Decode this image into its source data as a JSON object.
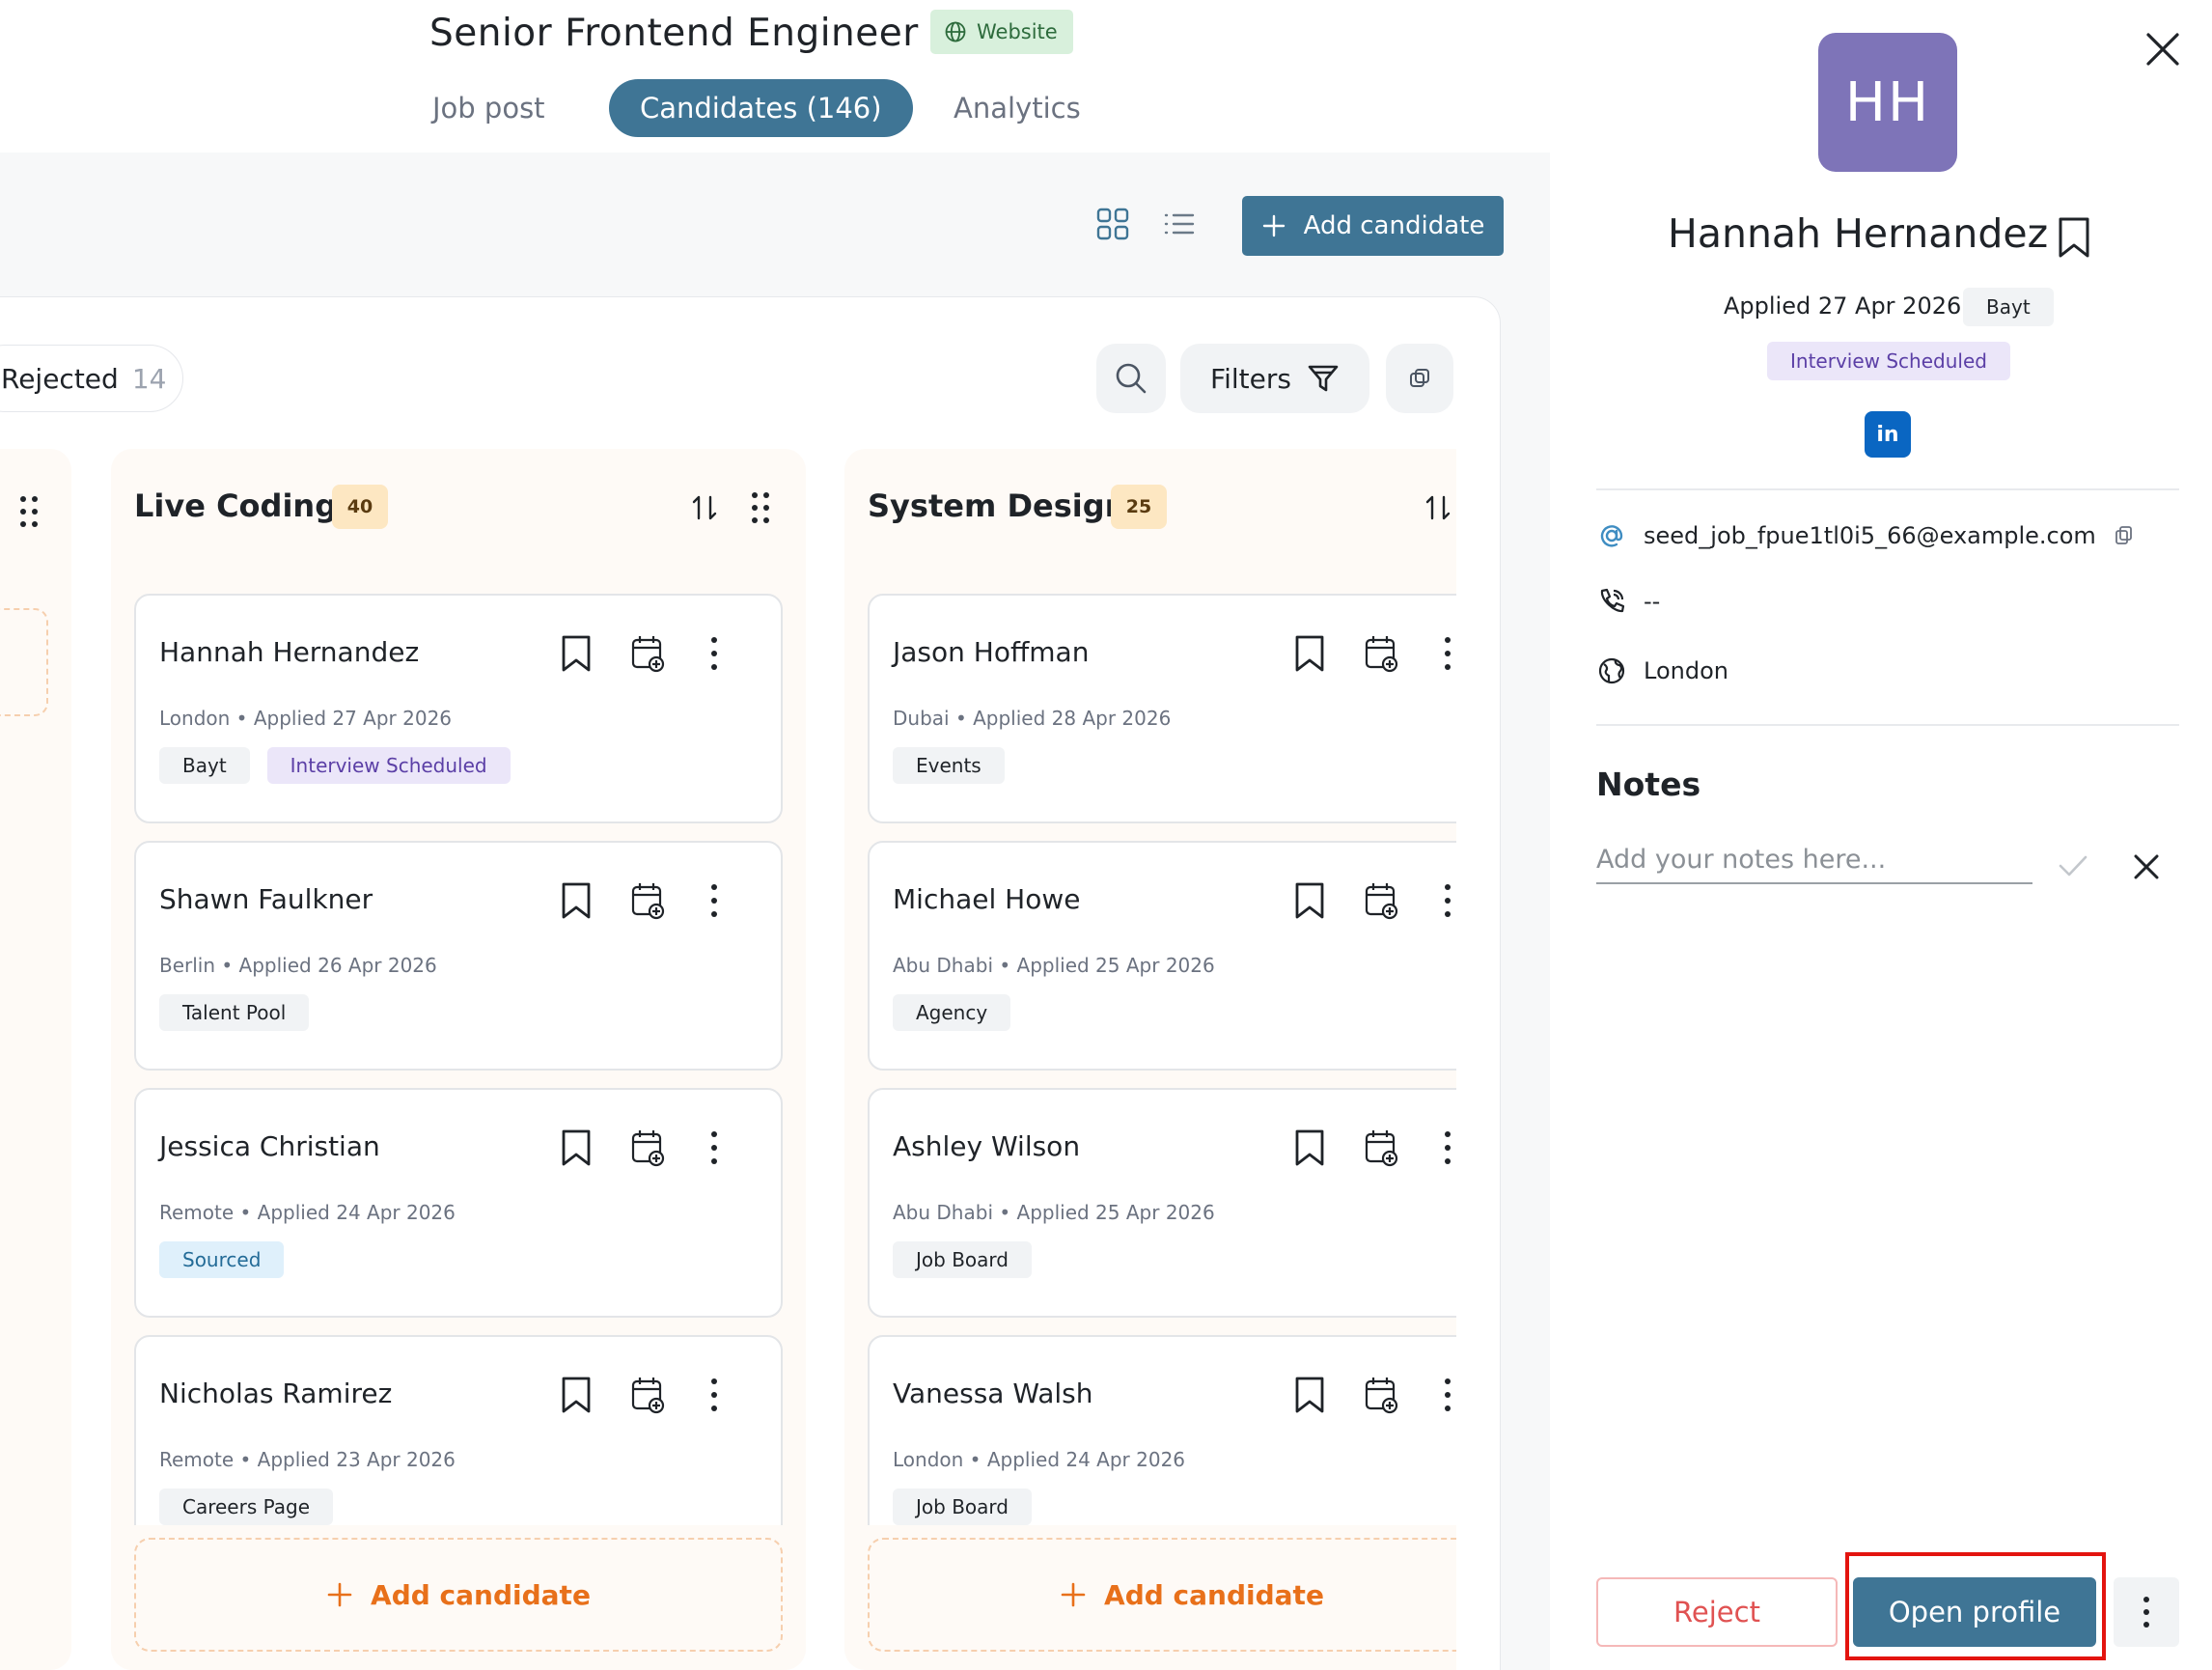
{
  "header": {
    "title": "Senior Frontend Engineer",
    "source_badge": "Website",
    "tabs": [
      {
        "label": "Job post",
        "active": false
      },
      {
        "label": "Candidates (146)",
        "active": true
      },
      {
        "label": "Analytics",
        "active": false
      }
    ]
  },
  "toolbar": {
    "add_candidate_label": "Add candidate",
    "filters_label": "Filters",
    "rejected_label": "Rejected",
    "rejected_count": "14"
  },
  "columns": [
    {
      "title": "Live Coding",
      "count": "40",
      "add_label": "Add candidate",
      "cards": [
        {
          "name": "Hannah Hernandez",
          "meta": "London • Applied 27 Apr 2026",
          "tags": [
            "Bayt",
            "Interview Scheduled"
          ]
        },
        {
          "name": "Shawn Faulkner",
          "meta": "Berlin • Applied 26 Apr 2026",
          "tags": [
            "Talent Pool"
          ]
        },
        {
          "name": "Jessica Christian",
          "meta": "Remote • Applied 24 Apr 2026",
          "tags": [
            "Sourced"
          ]
        },
        {
          "name": "Nicholas Ramirez",
          "meta": "Remote • Applied 23 Apr 2026",
          "tags": [
            "Careers Page"
          ]
        }
      ]
    },
    {
      "title": "System Design",
      "count": "25",
      "add_label": "Add candidate",
      "cards": [
        {
          "name": "Jason Hoffman",
          "meta": "Dubai • Applied 28 Apr 2026",
          "tags": [
            "Events"
          ]
        },
        {
          "name": "Michael Howe",
          "meta": "Abu Dhabi • Applied 25 Apr 2026",
          "tags": [
            "Agency"
          ]
        },
        {
          "name": "Ashley Wilson",
          "meta": "Abu Dhabi • Applied 25 Apr 2026",
          "tags": [
            "Job Board"
          ]
        },
        {
          "name": "Vanessa Walsh",
          "meta": "London • Applied 24 Apr 2026",
          "tags": [
            "Job Board"
          ]
        }
      ]
    }
  ],
  "candidate_panel": {
    "initials": "HH",
    "name": "Hannah Hernandez",
    "applied": "Applied 27 Apr 2026",
    "source": "Bayt",
    "status": "Interview Scheduled",
    "linkedin": "in",
    "email": "seed_job_fpue1tl0i5_66@example.com",
    "phone": "--",
    "location": "London",
    "notes_heading": "Notes",
    "notes_placeholder": "Add your notes here...",
    "reject_label": "Reject",
    "open_profile_label": "Open profile"
  },
  "colors": {
    "primary": "#3f7595",
    "accent_orange": "#e8701a",
    "avatar": "#7e74b8",
    "highlight": "#e3140f"
  }
}
